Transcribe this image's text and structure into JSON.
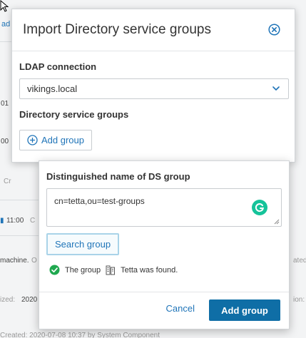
{
  "background": {
    "frag_ad": "ad",
    "frag_01": "01",
    "frag_00": "00",
    "frag_cr": "Cr",
    "frag_time": "11:00",
    "frag_c": "C",
    "frag_machine": "machine.",
    "frag_o": "O",
    "frag_ated": "ated:",
    "frag_ized": "ized:",
    "frag_2020": "2020",
    "frag_ion": "ion:",
    "frag_bottom": "Created: 2020-07-08 10:37 by System Component"
  },
  "dialog": {
    "title": "Import Directory service groups",
    "ldap_label": "LDAP connection",
    "ldap_value": "vikings.local",
    "groups_label": "Directory service groups",
    "add_group_label": "Add group"
  },
  "popover": {
    "dn_label": "Distinguished name of DS group",
    "dn_value": "cn=tetta,ou=test-groups",
    "search_label": "Search group",
    "found_prefix": "The group",
    "found_name": "Tetta was found.",
    "cancel_label": "Cancel",
    "add_label": "Add group"
  },
  "colors": {
    "accent": "#1f74b8",
    "primary_button": "#0f6ea6",
    "success": "#1fa84f",
    "grammarly": "#15c39a"
  }
}
